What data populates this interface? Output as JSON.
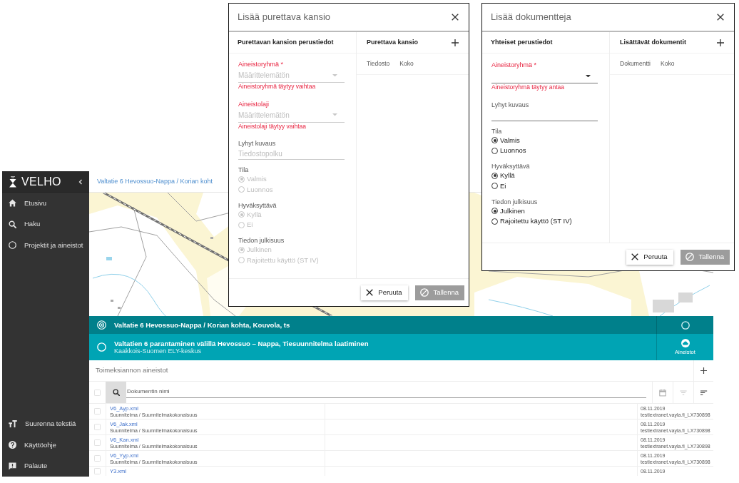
{
  "sidebar": {
    "logo": "VELHO",
    "items": [
      {
        "label": "Etusivu"
      },
      {
        "label": "Haku"
      },
      {
        "label": "Projektit ja aineistot"
      }
    ],
    "footer_items": [
      {
        "label": "Suurenna tekstiä"
      },
      {
        "label": "Käyttöohje"
      },
      {
        "label": "Palaute"
      }
    ]
  },
  "breadcrumb": "Valtatie 6 Hevossuo-Nappa / Korian koht",
  "hierarchy": [
    {
      "kind": "project",
      "title": "Valtatie 6 Hevossuo-Nappa / Korian kohta, Kouvola, ts"
    },
    {
      "kind": "assignment",
      "title": "Valtatien 6 parantaminen välillä Hevossuo – Nappa, Tiesuunnitelma laatiminen",
      "subtitle": "Kaakkois-Suomen ELY-keskus",
      "action": "Aineistot"
    }
  ],
  "documents": {
    "title": "Toimeksiannon aineistot",
    "select_all": {
      "checked": false
    },
    "search": {
      "placeholder": "Dokumentin nimi"
    },
    "rows": [
      {
        "checked": false,
        "name": "V6_Ayp.xml",
        "category": "Suunnitelma / Suunnitelmakokonaisuus",
        "date": "08.11.2019",
        "user": "testiextranet.vayla.fi_LX730898"
      },
      {
        "checked": false,
        "name": "V6_Jak.xml",
        "category": "Suunnitelma / Suunnitelmakokonaisuus",
        "date": "08.11.2019",
        "user": "testiextranet.vayla.fi_LX730898"
      },
      {
        "checked": false,
        "name": "V6_Kan.xml",
        "category": "Suunnitelma / Suunnitelmakokonaisuus",
        "date": "08.11.2019",
        "user": "testiextranet.vayla.fi_LX730898"
      },
      {
        "checked": false,
        "name": "V6_Yyp.xml",
        "category": "Suunnitelma / Suunnitelmakokonaisuus",
        "date": "08.11.2019",
        "user": "testiextranet.vayla.fi_LX730898"
      },
      {
        "checked": false,
        "name": "Y3.xml",
        "date": "08.11.2019"
      }
    ]
  },
  "dialogs": [
    {
      "title": "Lisää purettava kansio",
      "form_title": "Purettavan kansion perustiedot",
      "list_title": "Purettava kansio",
      "list_columns": [
        "Tiedosto",
        "Koko"
      ],
      "fields": [
        {
          "kind": "select",
          "label": "Aineistoryhmä *",
          "value": "Määrittelemätön",
          "error": "Aineistoryhmä täytyy vaihtaa",
          "disabled": true
        },
        {
          "kind": "select",
          "label": "Aineistolaji",
          "value": "Määrittelemätön",
          "error": "Aineistolaji täytyy vaihtaa",
          "disabled": true
        },
        {
          "kind": "text",
          "label": "Lyhyt kuvaus",
          "value": "Tiedostopolku",
          "disabled": true
        },
        {
          "kind": "radio_group",
          "label": "Tila",
          "disabled": true,
          "options": [
            {
              "label": "Valmis",
              "selected": true
            },
            {
              "label": "Luonnos",
              "selected": false
            }
          ]
        },
        {
          "kind": "radio_group",
          "label": "Hyväksyttävä",
          "disabled": true,
          "options": [
            {
              "label": "Kyllä",
              "selected": true
            },
            {
              "label": "Ei",
              "selected": false
            }
          ]
        },
        {
          "kind": "radio_group",
          "label": "Tiedon julkisuus",
          "disabled": true,
          "options": [
            {
              "label": "Julkinen",
              "selected": true
            },
            {
              "label": "Rajoitettu käyttö (ST IV)",
              "selected": false
            }
          ]
        }
      ],
      "buttons": [
        {
          "label": "Peruuta",
          "disabled": false
        },
        {
          "label": "Tallenna",
          "disabled": true
        }
      ]
    },
    {
      "title": "Lisää dokumentteja",
      "form_title": "Yhteiset perustiedot",
      "list_title": "Lisättävät dokumentit",
      "list_columns": [
        "Dokumentti",
        "Koko"
      ],
      "fields": [
        {
          "kind": "select",
          "label": "Aineistoryhmä *",
          "error": "Aineistoryhmä täytyy antaa",
          "disabled": false
        },
        {
          "kind": "text",
          "label": "Lyhyt kuvaus",
          "disabled": false
        },
        {
          "kind": "radio_group",
          "label": "Tila",
          "disabled": false,
          "options": [
            {
              "label": "Valmis",
              "selected": true
            },
            {
              "label": "Luonnos",
              "selected": false
            }
          ]
        },
        {
          "kind": "radio_group",
          "label": "Hyväksyttävä",
          "disabled": false,
          "options": [
            {
              "label": "Kyllä",
              "selected": true
            },
            {
              "label": "Ei",
              "selected": false
            }
          ]
        },
        {
          "kind": "radio_group",
          "label": "Tiedon julkisuus",
          "disabled": false,
          "options": [
            {
              "label": "Julkinen",
              "selected": true
            },
            {
              "label": "Rajoitettu käyttö (ST IV)",
              "selected": false
            }
          ]
        }
      ],
      "buttons": [
        {
          "label": "Peruuta",
          "disabled": false
        },
        {
          "label": "Tallenna",
          "disabled": true
        }
      ]
    }
  ]
}
